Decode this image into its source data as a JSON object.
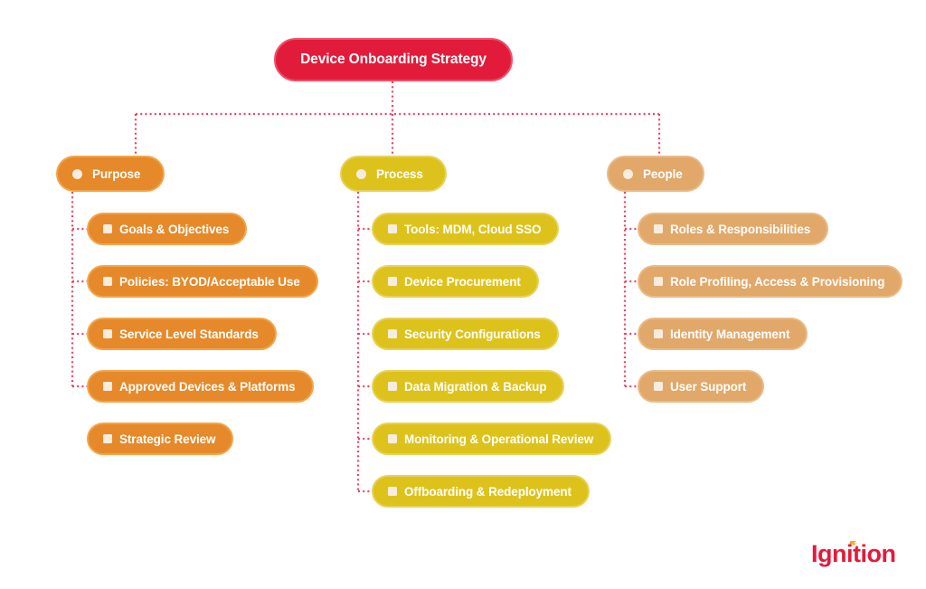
{
  "root": {
    "label": "Device Onboarding Strategy",
    "color": "#e31b3b"
  },
  "connector_color": "#f0425f",
  "categories": [
    {
      "label": "Purpose",
      "color": "#e6892a",
      "items": [
        {
          "label": "Goals & Objectives",
          "connected": true
        },
        {
          "label": "Policies: BYOD/Acceptable Use",
          "connected": true
        },
        {
          "label": "Service Level Standards",
          "connected": true
        },
        {
          "label": "Approved Devices & Platforms",
          "connected": true
        },
        {
          "label": "Strategic Review",
          "connected": false
        }
      ]
    },
    {
      "label": "Process",
      "color": "#dec21c",
      "items": [
        {
          "label": "Tools: MDM, Cloud SSO",
          "connected": true
        },
        {
          "label": "Device Procurement",
          "connected": true
        },
        {
          "label": "Security Configurations",
          "connected": true
        },
        {
          "label": "Data Migration & Backup",
          "connected": true
        },
        {
          "label": "Monitoring & Operational Review",
          "connected": true
        },
        {
          "label": "Offboarding & Redeployment",
          "connected": true
        }
      ]
    },
    {
      "label": "People",
      "color": "#e1a86a",
      "items": [
        {
          "label": "Roles & Responsibilities",
          "connected": true
        },
        {
          "label": "Role Profiling, Access & Provisioning",
          "connected": true
        },
        {
          "label": "Identity Management",
          "connected": true
        },
        {
          "label": "User Support",
          "connected": true
        }
      ]
    }
  ],
  "logo": {
    "text": "Ignition",
    "color": "#e31b3b",
    "spark_color": "#f5a623"
  }
}
